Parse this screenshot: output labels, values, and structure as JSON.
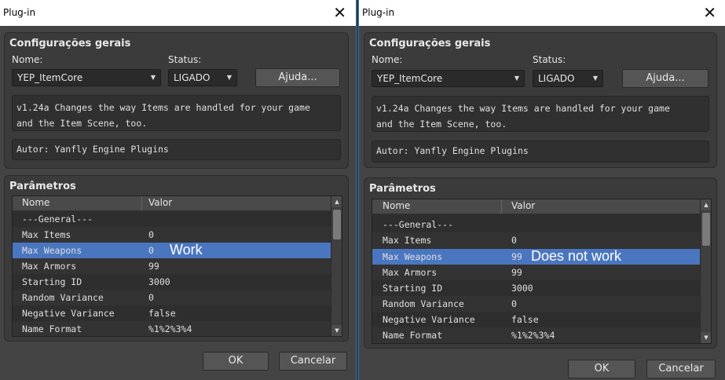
{
  "windows": [
    {
      "title": "Plug-in",
      "general": {
        "heading": "Configurações gerais",
        "name_label": "Nome:",
        "name_value": "YEP_ItemCore",
        "status_label": "Status:",
        "status_value": "LIGADO",
        "help_button": "Ajuda...",
        "description": "v1.24a Changes the way Items are handled for your game\nand the Item Scene, too.",
        "author": "Autor: Yanfly Engine Plugins"
      },
      "params": {
        "heading": "Parâmetros",
        "col_name": "Nome",
        "col_value": "Valor",
        "rows": [
          {
            "name": "---General---",
            "value": ""
          },
          {
            "name": "Max Items",
            "value": "0"
          },
          {
            "name": "Max Weapons",
            "value": "0"
          },
          {
            "name": "Max Armors",
            "value": "99"
          },
          {
            "name": "Starting ID",
            "value": "3000"
          },
          {
            "name": "Random Variance",
            "value": "0"
          },
          {
            "name": "Negative Variance",
            "value": "false"
          },
          {
            "name": "Name Format",
            "value": "%1%2%3%4"
          }
        ],
        "selected_index": 2
      },
      "annotation": "Work",
      "ok_button": "OK",
      "cancel_button": "Cancelar"
    },
    {
      "title": "Plug-in",
      "general": {
        "heading": "Configurações gerais",
        "name_label": "Nome:",
        "name_value": "YEP_ItemCore",
        "status_label": "Status:",
        "status_value": "LIGADO",
        "help_button": "Ajuda...",
        "description": "v1.24a Changes the way Items are handled for your game\nand the Item Scene, too.",
        "author": "Autor: Yanfly Engine Plugins"
      },
      "params": {
        "heading": "Parâmetros",
        "col_name": "Nome",
        "col_value": "Valor",
        "rows": [
          {
            "name": "---General---",
            "value": ""
          },
          {
            "name": "Max Items",
            "value": "0"
          },
          {
            "name": "Max Weapons",
            "value": "99"
          },
          {
            "name": "Max Armors",
            "value": "99"
          },
          {
            "name": "Starting ID",
            "value": "3000"
          },
          {
            "name": "Random Variance",
            "value": "0"
          },
          {
            "name": "Negative Variance",
            "value": "false"
          },
          {
            "name": "Name Format",
            "value": "%1%2%3%4"
          }
        ],
        "selected_index": 2
      },
      "annotation": "Does not work",
      "ok_button": "OK",
      "cancel_button": "Cancelar"
    }
  ],
  "icons": {
    "close": "close-icon",
    "dropdown": "chevron-down-icon",
    "scroll_up": "scroll-up-icon",
    "scroll_down": "scroll-down-icon"
  },
  "colors": {
    "selection": "#4a76c0",
    "window_border": "#2a6fb3",
    "dialog_bg": "#444444"
  }
}
